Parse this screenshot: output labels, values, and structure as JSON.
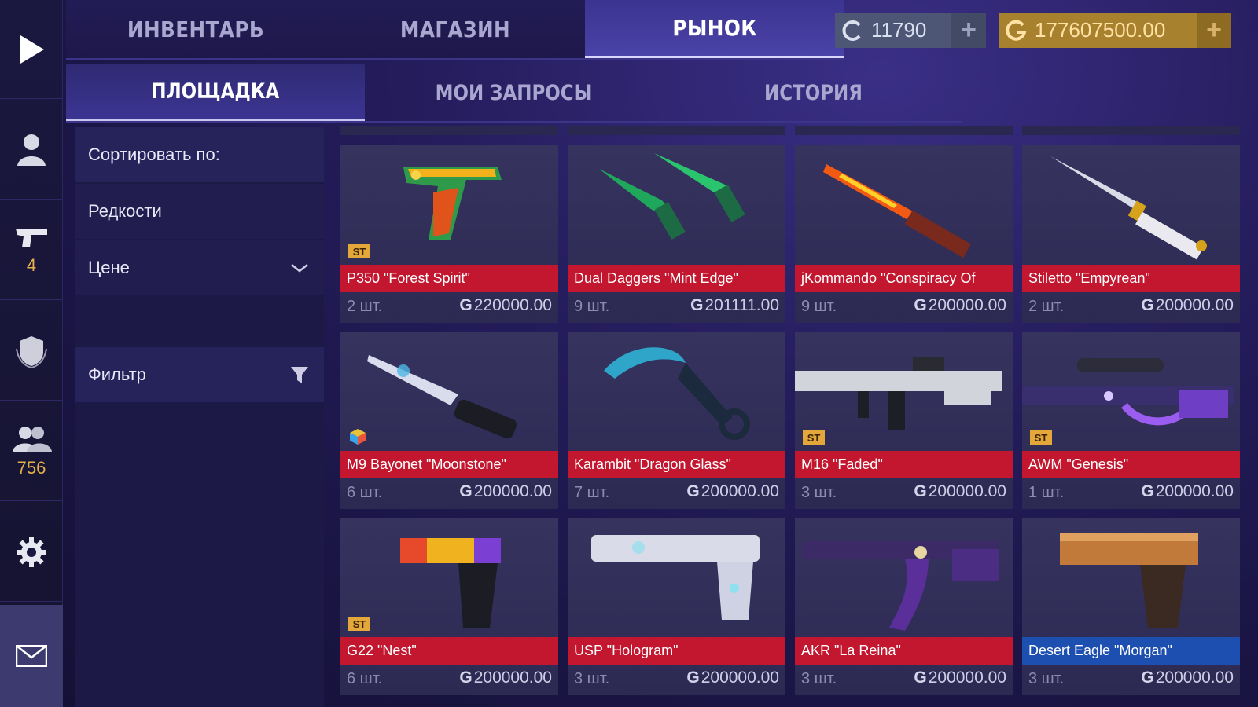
{
  "top_tabs": [
    {
      "label": "ИНВЕНТАРЬ"
    },
    {
      "label": "МАГАЗИН"
    },
    {
      "label": "РЫНОК"
    }
  ],
  "currency": {
    "silver": {
      "value": "11790",
      "plus": "+"
    },
    "gold": {
      "value": "177607500.00",
      "plus": "+"
    }
  },
  "sub_tabs": [
    {
      "label": "ПЛОЩАДКА"
    },
    {
      "label": "МОИ ЗАПРОСЫ"
    },
    {
      "label": "ИСТОРИЯ"
    }
  ],
  "sidebar": {
    "guns_count": "4",
    "friends_count": "756"
  },
  "sort": {
    "title": "Сортировать по:",
    "rarity": "Редкости",
    "price": "Цене",
    "filter": "Фильтр"
  },
  "price_symbol": "G",
  "items": [
    {
      "name": "P350 \"Forest Spirit\"",
      "qty": "2 шт.",
      "price": "220000.00",
      "badge": "ST",
      "color": "red"
    },
    {
      "name": "Dual Daggers \"Mint Edge\"",
      "qty": "9 шт.",
      "price": "201111.00",
      "badge": "",
      "color": "red"
    },
    {
      "name": "jKommando \"Conspiracy Of",
      "qty": "9 шт.",
      "price": "200000.00",
      "badge": "",
      "color": "red"
    },
    {
      "name": "Stiletto \"Empyrean\"",
      "qty": "2 шт.",
      "price": "200000.00",
      "badge": "",
      "color": "red"
    },
    {
      "name": "M9 Bayonet \"Moonstone\"",
      "qty": "6 шт.",
      "price": "200000.00",
      "badge": "cube",
      "color": "red"
    },
    {
      "name": "Karambit \"Dragon Glass\"",
      "qty": "7 шт.",
      "price": "200000.00",
      "badge": "",
      "color": "red"
    },
    {
      "name": "M16 \"Faded\"",
      "qty": "3 шт.",
      "price": "200000.00",
      "badge": "ST",
      "color": "red"
    },
    {
      "name": "AWM \"Genesis\"",
      "qty": "1 шт.",
      "price": "200000.00",
      "badge": "ST",
      "color": "red"
    },
    {
      "name": "G22 \"Nest\"",
      "qty": "6 шт.",
      "price": "200000.00",
      "badge": "ST",
      "color": "red"
    },
    {
      "name": "USP \"Hologram\"",
      "qty": "3 шт.",
      "price": "200000.00",
      "badge": "",
      "color": "red"
    },
    {
      "name": "AKR \"La Reina\"",
      "qty": "3 шт.",
      "price": "200000.00",
      "badge": "",
      "color": "red"
    },
    {
      "name": "Desert Eagle \"Morgan\"",
      "qty": "3 шт.",
      "price": "200000.00",
      "badge": "",
      "color": "blue"
    }
  ],
  "colors": {
    "accent": "#3b3490",
    "rarity_red": "#c3162f",
    "rarity_blue": "#1d4fb1",
    "gold": "#a8812e"
  }
}
